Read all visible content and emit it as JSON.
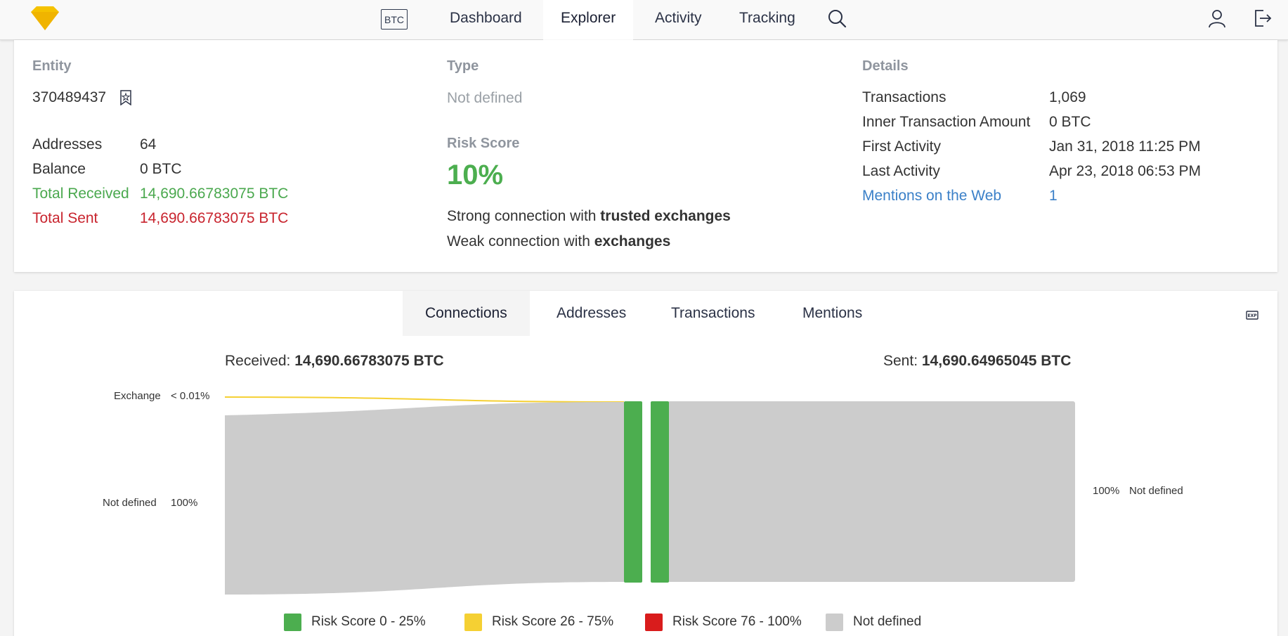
{
  "nav": {
    "currency": "BTC",
    "items": [
      "Dashboard",
      "Explorer",
      "Activity",
      "Tracking"
    ],
    "active": "Explorer"
  },
  "entity": {
    "title": "Entity",
    "id": "370489437",
    "rows": [
      {
        "label": "Addresses",
        "value": "64"
      },
      {
        "label": "Balance",
        "value": "0 BTC"
      },
      {
        "label": "Total Received",
        "value": "14,690.66783075 BTC"
      },
      {
        "label": "Total Sent",
        "value": "14,690.66783075 BTC"
      }
    ]
  },
  "type": {
    "title": "Type",
    "value": "Not defined",
    "risk_title": "Risk Score",
    "risk_value": "10%",
    "connections": [
      {
        "prefix": "Strong connection with ",
        "target": "trusted exchanges"
      },
      {
        "prefix": "Weak connection with ",
        "target": "exchanges"
      }
    ]
  },
  "details": {
    "title": "Details",
    "rows": [
      {
        "label": "Transactions",
        "value": "1,069"
      },
      {
        "label": "Inner Transaction Amount",
        "value": "0 BTC"
      },
      {
        "label": "First Activity",
        "value": "Jan 31, 2018 11:25 PM"
      },
      {
        "label": "Last Activity",
        "value": "Apr 23, 2018 06:53 PM"
      },
      {
        "label": "Mentions on the Web",
        "value": "1"
      }
    ]
  },
  "tabs": {
    "items": [
      "Connections",
      "Addresses",
      "Transactions",
      "Mentions"
    ],
    "active": "Connections"
  },
  "flow": {
    "received_label": "Received: ",
    "received_value": "14,690.66783075 BTC",
    "sent_label": "Sent: ",
    "sent_value": "14,690.64965045 BTC",
    "inputs": [
      {
        "name": "Exchange",
        "pct": "< 0.01%",
        "color": "#f5d033"
      },
      {
        "name": "Not defined",
        "pct": "100%",
        "color": "#cccccc"
      }
    ],
    "outputs": [
      {
        "name": "Not defined",
        "pct": "100%",
        "color": "#cccccc"
      }
    ],
    "node_color": "#4cae4f"
  },
  "legend": [
    {
      "label": "Risk Score 0 - 25%",
      "color": "#4cae4f"
    },
    {
      "label": "Risk Score 26 - 75%",
      "color": "#f5d033"
    },
    {
      "label": "Risk Score 76 - 100%",
      "color": "#d91c1c"
    },
    {
      "label": "Not defined",
      "color": "#cccccc"
    }
  ]
}
